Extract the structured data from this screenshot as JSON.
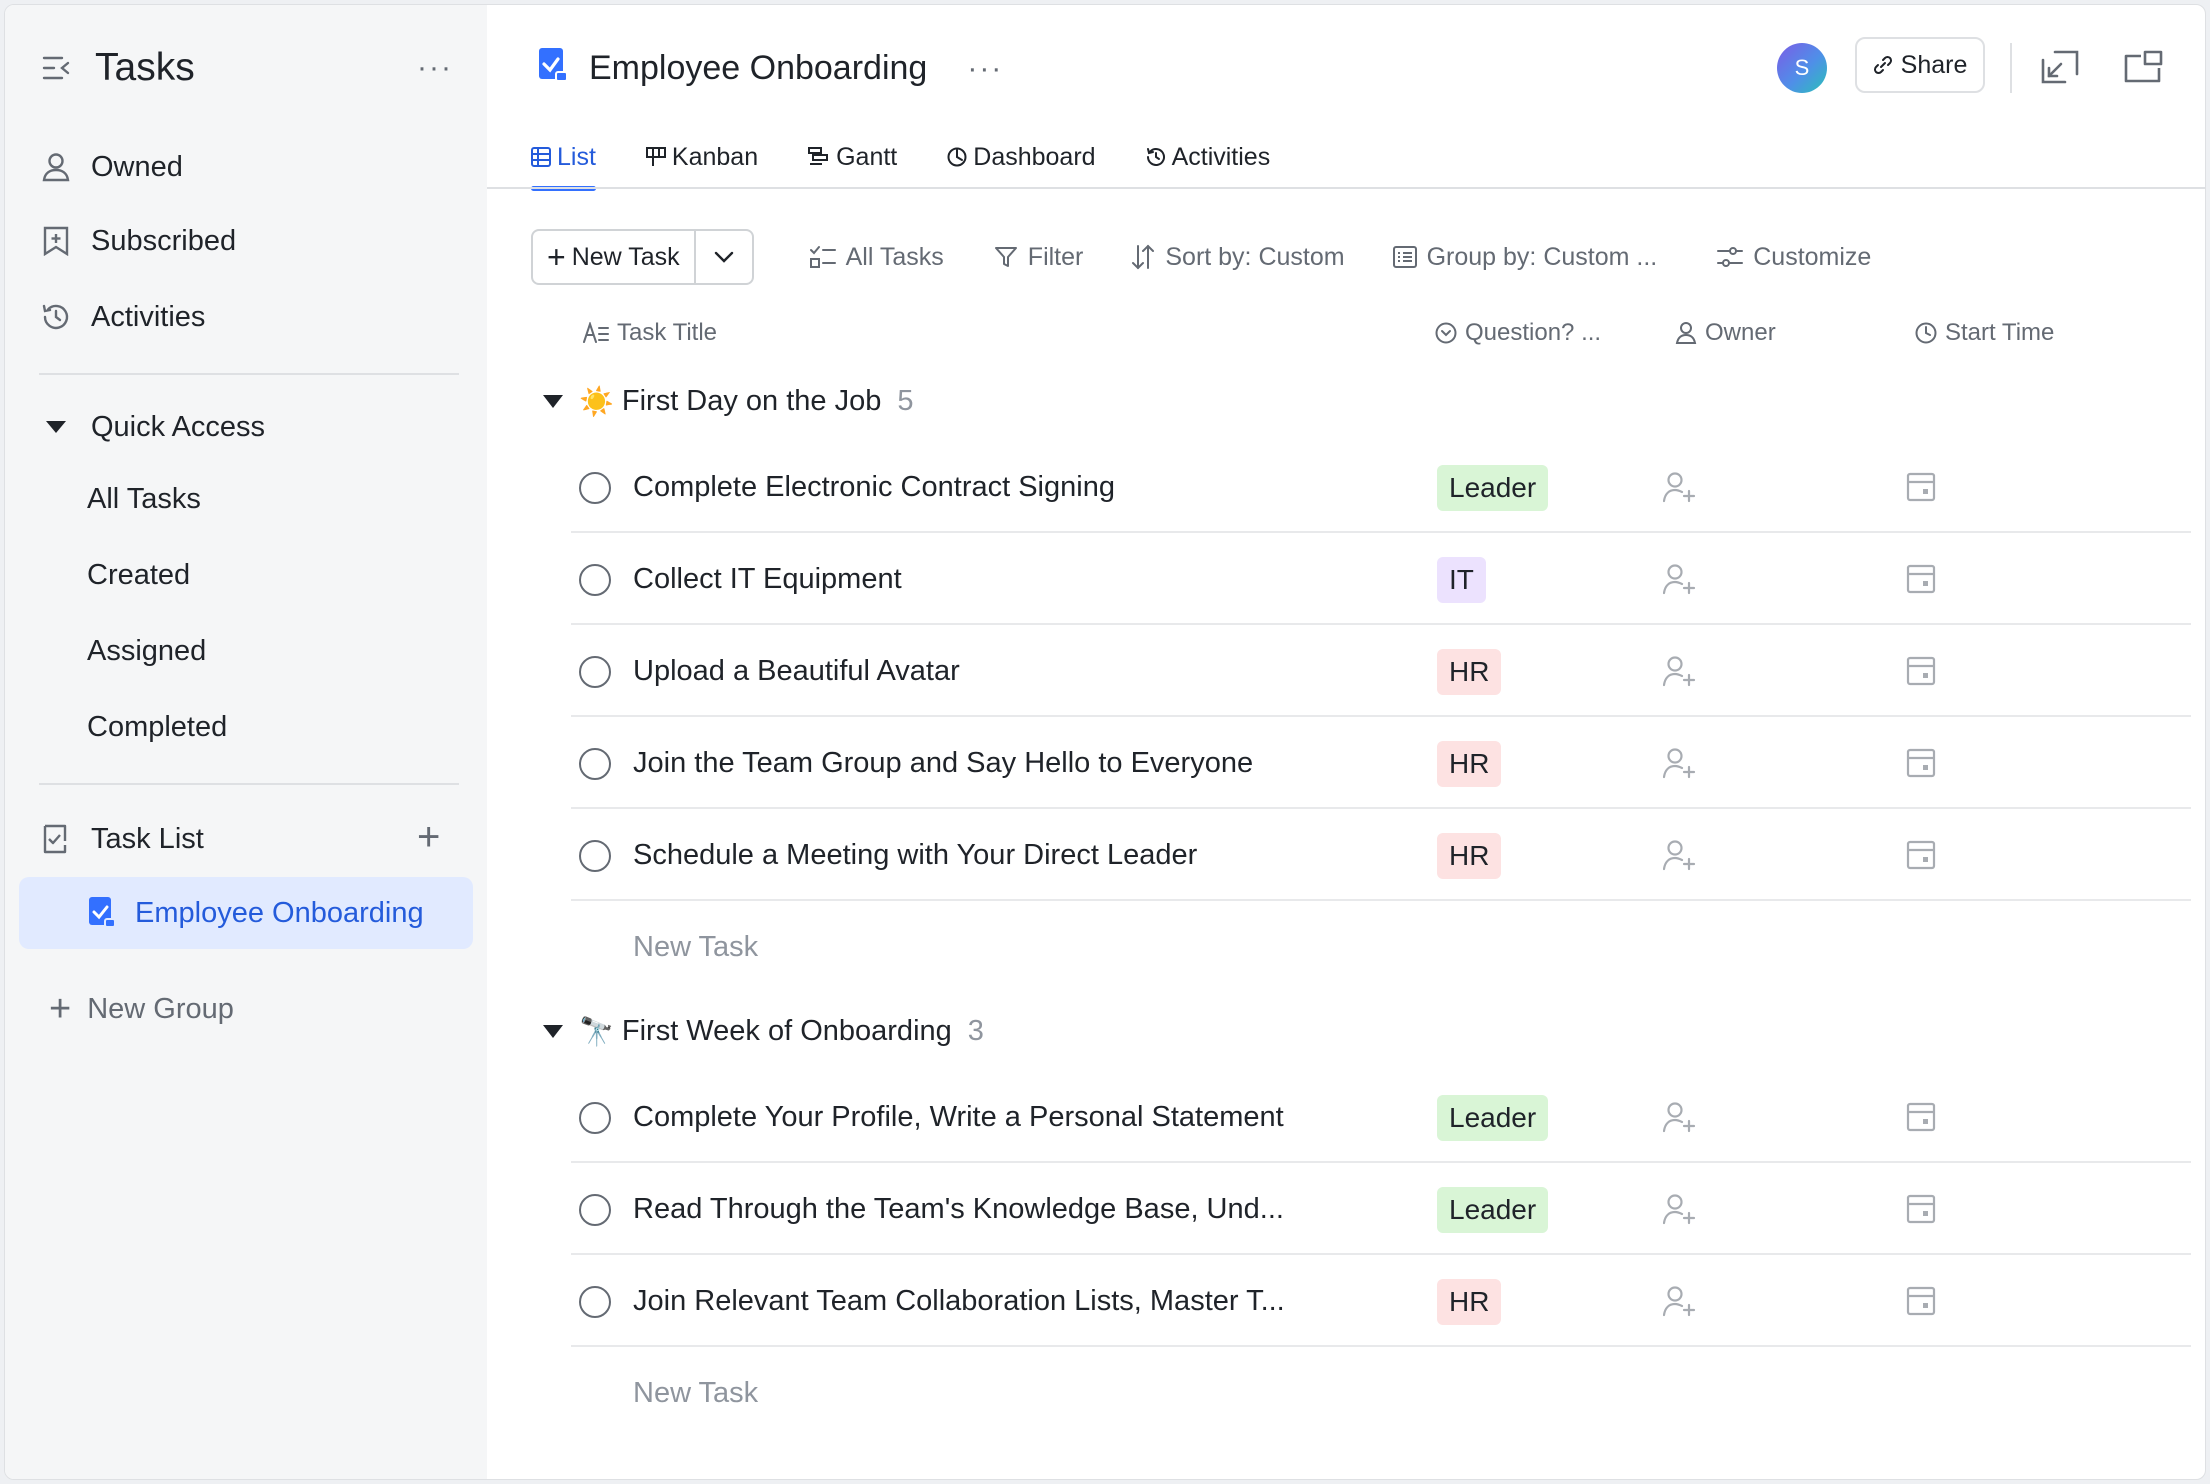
{
  "sidebar": {
    "title": "Tasks",
    "nav": [
      {
        "label": "Owned",
        "icon": "person-icon"
      },
      {
        "label": "Subscribed",
        "icon": "bookmark-icon"
      },
      {
        "label": "Activities",
        "icon": "history-icon"
      }
    ],
    "quick_access": {
      "label": "Quick Access",
      "items": [
        "All Tasks",
        "Created",
        "Assigned",
        "Completed"
      ]
    },
    "task_list": {
      "label": "Task List",
      "active_item": "Employee Onboarding"
    },
    "new_group": "New Group"
  },
  "header": {
    "title": "Employee Onboarding",
    "avatar_initial": "S",
    "share_label": "Share"
  },
  "tabs": [
    {
      "label": "List",
      "active": true
    },
    {
      "label": "Kanban"
    },
    {
      "label": "Gantt"
    },
    {
      "label": "Dashboard"
    },
    {
      "label": "Activities"
    }
  ],
  "toolbar": {
    "new_task": "New Task",
    "all_tasks": "All Tasks",
    "filter": "Filter",
    "sort": "Sort by: Custom",
    "group": "Group by: Custom ...",
    "customize": "Customize"
  },
  "columns": {
    "title": "Task Title",
    "question": "Question? ...",
    "owner": "Owner",
    "start": "Start Time"
  },
  "groups": [
    {
      "emoji": "☀️",
      "name": "First Day on the Job",
      "count": "5",
      "tasks": [
        {
          "title": "Complete Electronic Contract Signing",
          "tag": "Leader"
        },
        {
          "title": "Collect IT Equipment",
          "tag": "IT"
        },
        {
          "title": "Upload a Beautiful Avatar",
          "tag": "HR"
        },
        {
          "title": "Join the Team Group and Say Hello to Everyone",
          "tag": "HR"
        },
        {
          "title": "Schedule a Meeting with Your Direct Leader",
          "tag": "HR"
        }
      ],
      "new_task": "New Task"
    },
    {
      "emoji": "🔭",
      "name": "First Week of Onboarding",
      "count": "3",
      "tasks": [
        {
          "title": "Complete Your Profile, Write a Personal Statement",
          "tag": "Leader"
        },
        {
          "title": "Read Through the Team's Knowledge Base, Und...",
          "tag": "Leader"
        },
        {
          "title": "Join Relevant Team Collaboration Lists, Master T...",
          "tag": "HR"
        }
      ],
      "new_task": "New Task"
    }
  ],
  "colors": {
    "accent": "#3370ff",
    "active_text": "#245bdb",
    "active_bg": "#e1eaff",
    "tag_leader": "#d9f5d6",
    "tag_it": "#ece2fe",
    "tag_hr": "#fde2e2"
  }
}
